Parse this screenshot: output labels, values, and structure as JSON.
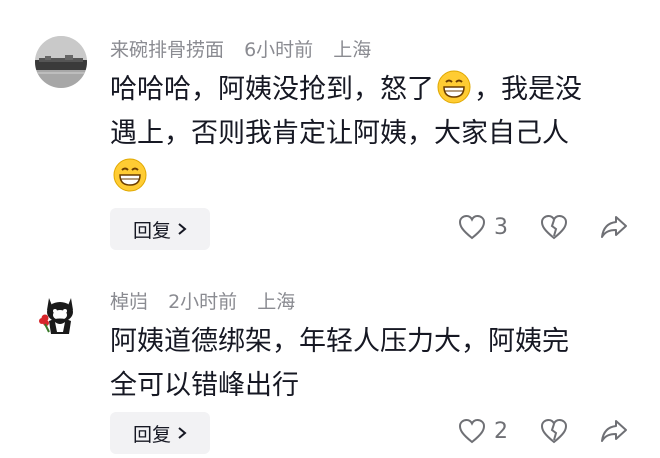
{
  "comments": [
    {
      "username": "来碗排骨捞面",
      "time": "6小时前",
      "location": "上海",
      "text_line1_a": "哈哈哈，阿姨没抢到，怒了",
      "text_line1_b": "，我是没",
      "text_line2": "遇上，否则我肯定让阿姨，大家自己人",
      "reply_label": "回复",
      "like_count": "3",
      "avatar_icon": "night-lake-scenery",
      "emoji_icon": "grinning-face-emoji"
    },
    {
      "username": "棹岿",
      "time": "2小时前",
      "location": "上海",
      "text_line1": "阿姨道德绑架，年轻人压力大，阿姨完",
      "text_line2": "全可以错峰出行",
      "reply_label": "回复",
      "like_count": "2",
      "avatar_icon": "cartoon-cat-with-flower"
    }
  ]
}
